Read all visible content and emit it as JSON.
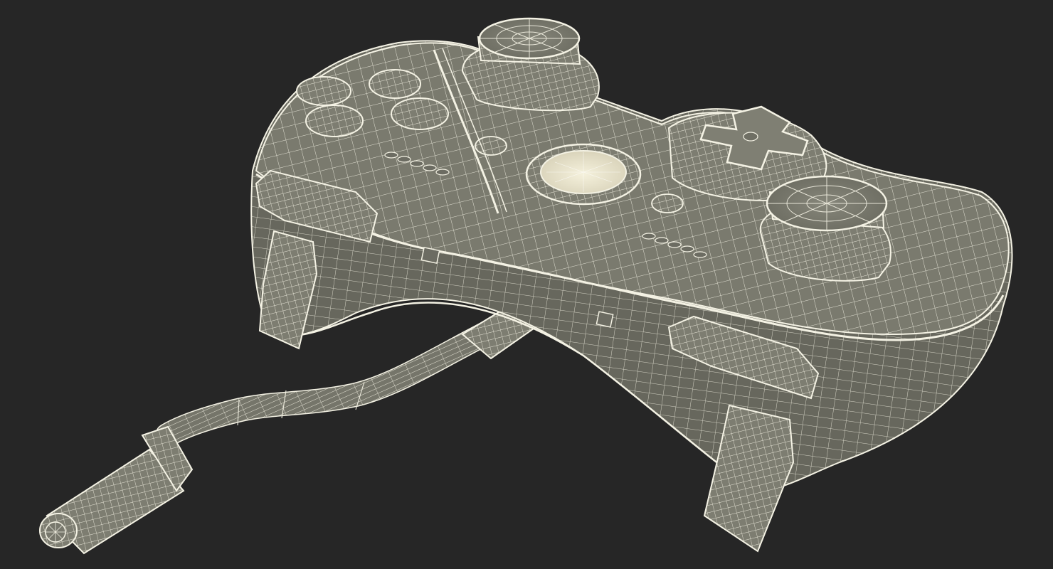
{
  "scene": {
    "subject": "wired-game-controller-wireframe",
    "background_color": "#262626",
    "surface_color": "#7b7b6f",
    "surface_shadow_color": "#5f5f55",
    "wire_color": "#f4f2e4",
    "highlight_color": "#f1ecd6"
  }
}
